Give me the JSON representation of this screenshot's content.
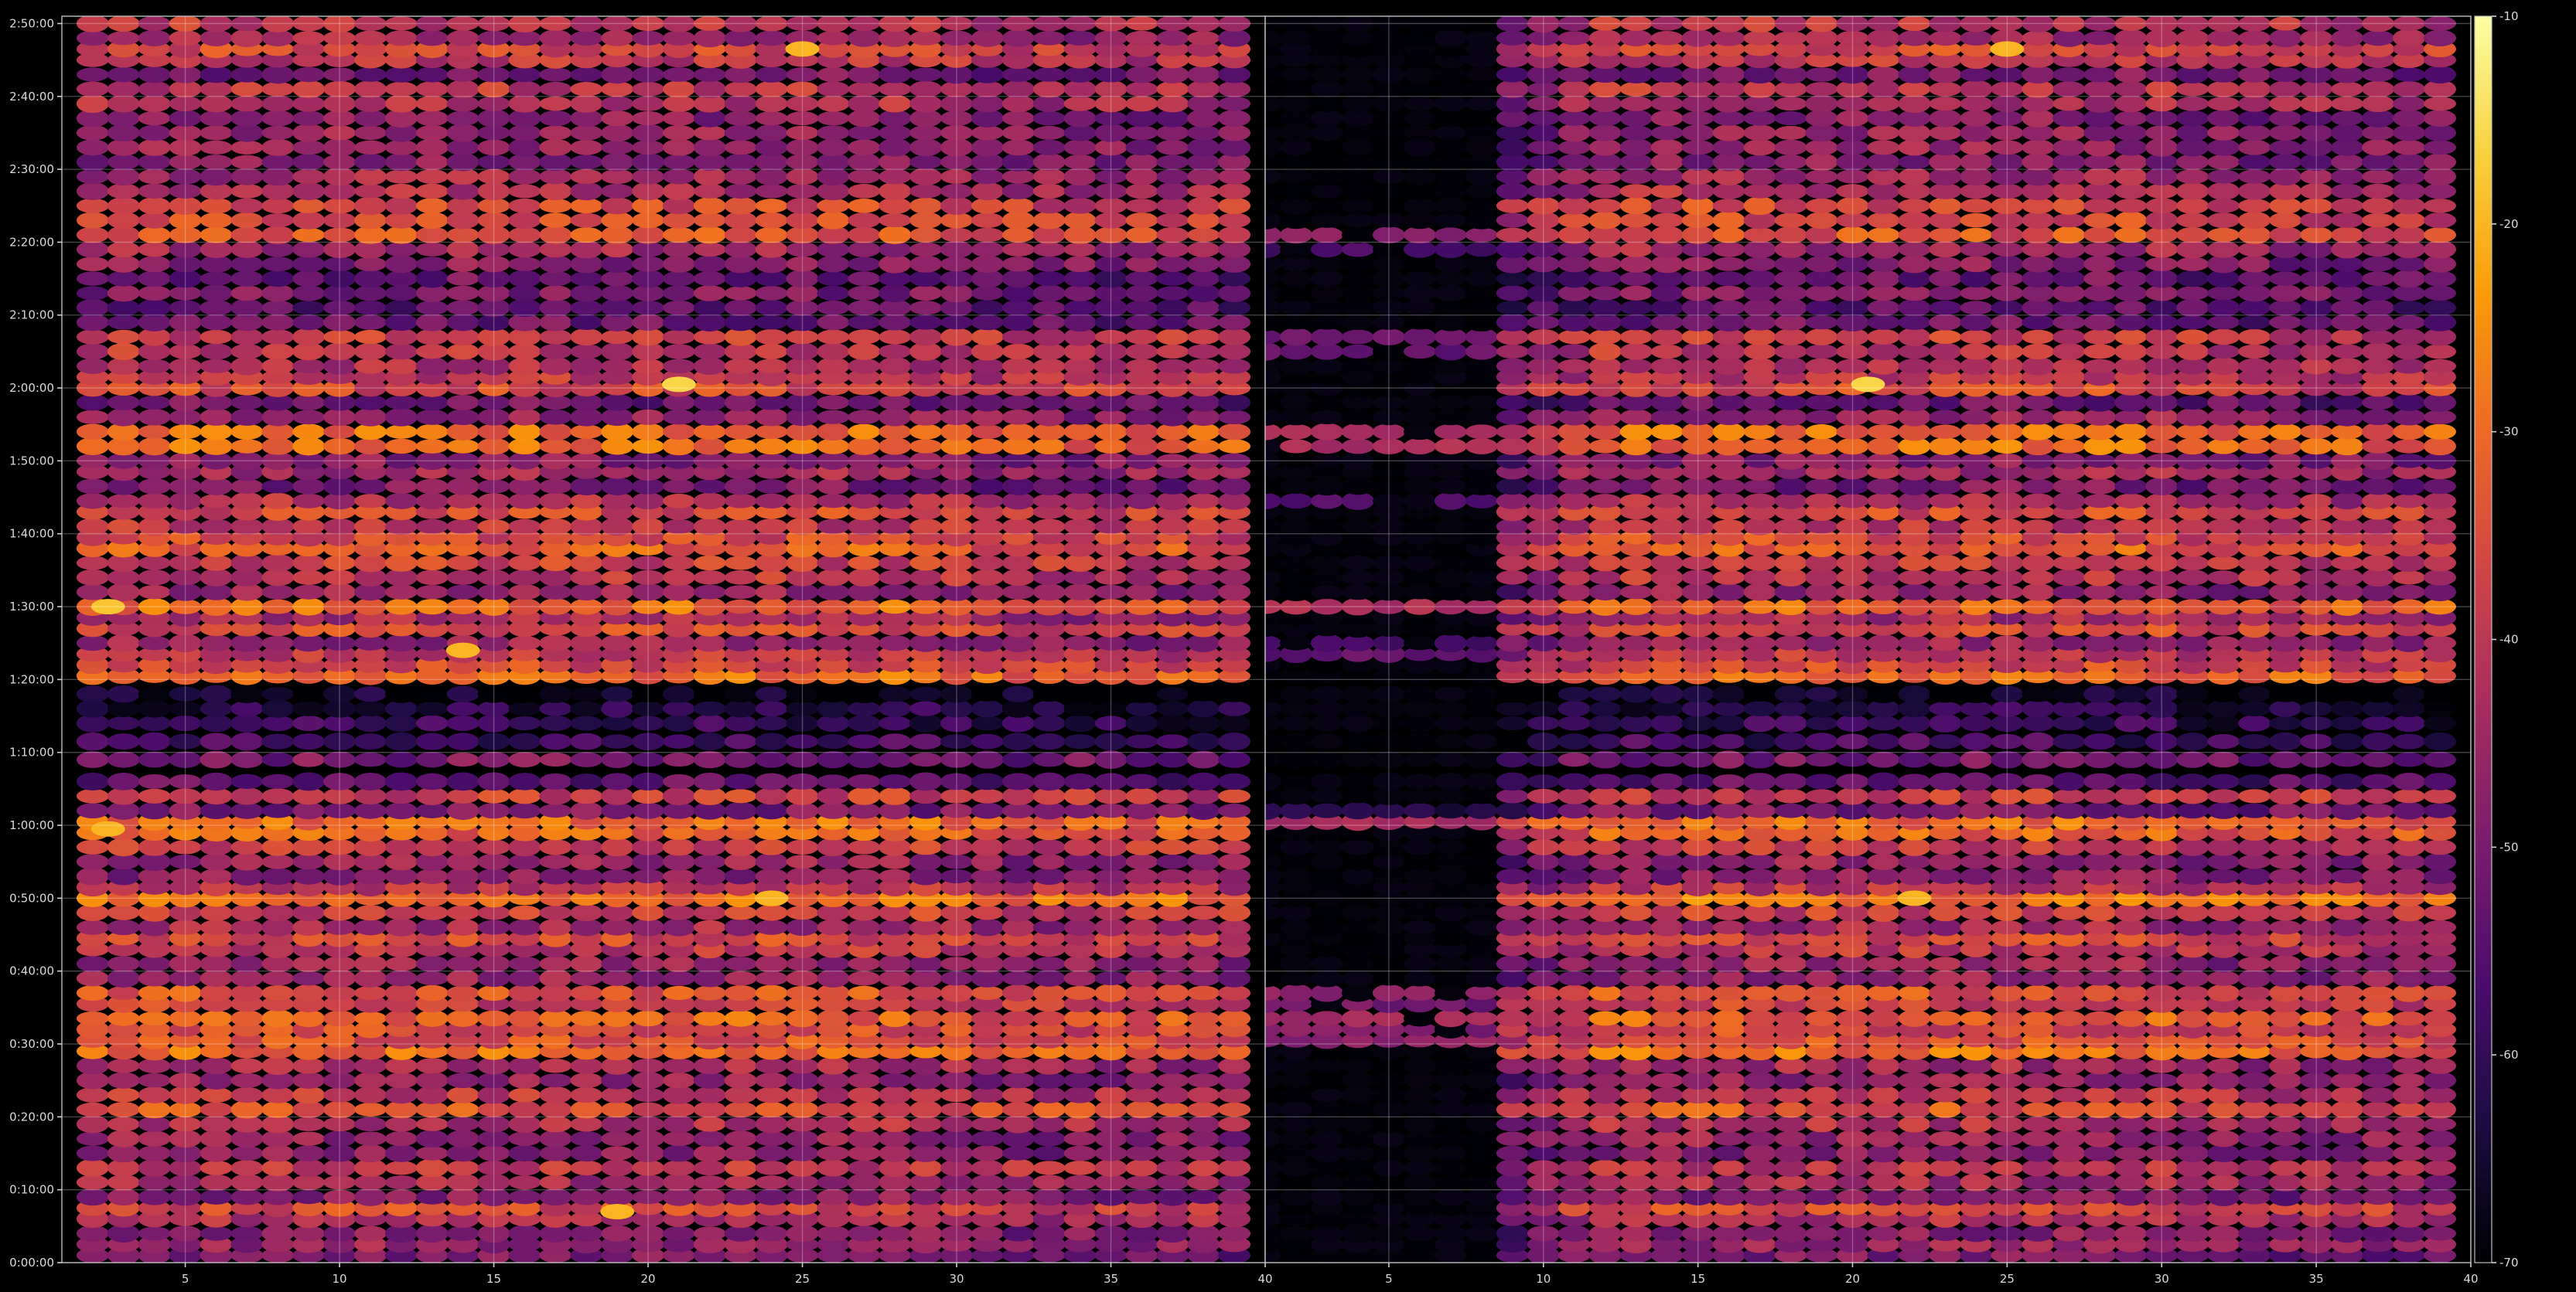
{
  "chart_data": {
    "type": "heatmap",
    "title": "",
    "xlabel": "",
    "ylabel": "",
    "grid": true,
    "colormap": "inferno",
    "colormap_stops": [
      "#000004",
      "#1b0c41",
      "#4a0c6b",
      "#781c6d",
      "#a52c60",
      "#cf4446",
      "#ed6925",
      "#fb9b06",
      "#f7d13d",
      "#fcffa4"
    ],
    "background": "#000000",
    "colorbar": {
      "range": [
        -70,
        -10
      ],
      "ticks": [
        -10,
        -20,
        -30,
        -40,
        -50,
        -60,
        -70
      ],
      "tick_labels": [
        "-10",
        "-20",
        "-30",
        "-40",
        "-50",
        "-60",
        "-70"
      ]
    },
    "panels": [
      {
        "name": "left",
        "xlim": [
          1,
          40
        ],
        "x_ticks": [
          5,
          10,
          15,
          20,
          25,
          30,
          35,
          40
        ],
        "x_tick_labels": [
          "5",
          "10",
          "15",
          "20",
          "25",
          "30",
          "35",
          "40"
        ],
        "x_values": [
          2,
          39
        ],
        "y_tick_labels": [
          "0:00:00",
          "0:10:00",
          "0:20:00",
          "0:30:00",
          "0:40:00",
          "0:50:00",
          "1:00:00",
          "1:10:00",
          "1:20:00",
          "1:30:00",
          "1:40:00",
          "1:50:00",
          "2:00:00",
          "2:10:00",
          "2:20:00",
          "2:30:00",
          "2:40:00",
          "2:50:00"
        ]
      },
      {
        "name": "right",
        "xlim": [
          1,
          40
        ],
        "x_ticks": [
          5,
          10,
          15,
          20,
          25,
          30,
          35,
          40
        ],
        "x_tick_labels": [
          "5",
          "10",
          "15",
          "20",
          "25",
          "30",
          "35",
          "40"
        ],
        "x_values": [
          1,
          39
        ]
      }
    ],
    "ylim_minutes": [
      0,
      171
    ],
    "y_ticks_minutes": [
      0,
      10,
      20,
      30,
      40,
      50,
      60,
      70,
      80,
      90,
      100,
      110,
      120,
      130,
      140,
      150,
      160,
      170
    ],
    "left_rows": [
      {
        "minute": 1,
        "level": -50
      },
      {
        "minute": 2.5,
        "level": -46
      },
      {
        "minute": 4,
        "level": -48
      },
      {
        "minute": 6,
        "level": -42
      },
      {
        "minute": 7.5,
        "level": -36
      },
      {
        "minute": 9,
        "level": -48
      },
      {
        "minute": 11,
        "level": -44
      },
      {
        "minute": 13,
        "level": -40
      },
      {
        "minute": 15,
        "level": -48
      },
      {
        "minute": 17,
        "level": -46
      },
      {
        "minute": 19,
        "level": -42
      },
      {
        "minute": 21,
        "level": -34
      },
      {
        "minute": 23,
        "level": -40
      },
      {
        "minute": 25,
        "level": -46
      },
      {
        "minute": 27,
        "level": -44
      },
      {
        "minute": 29,
        "level": -30
      },
      {
        "minute": 30.5,
        "level": -34
      },
      {
        "minute": 32,
        "level": -36
      },
      {
        "minute": 33.5,
        "level": -32
      },
      {
        "minute": 35.5,
        "level": -38
      },
      {
        "minute": 37,
        "level": -34
      },
      {
        "minute": 39,
        "level": -46
      },
      {
        "minute": 41,
        "level": -46
      },
      {
        "minute": 43,
        "level": -40
      },
      {
        "minute": 44.5,
        "level": -36
      },
      {
        "minute": 46,
        "level": -44
      },
      {
        "minute": 48,
        "level": -38
      },
      {
        "minute": 50,
        "level": -28
      },
      {
        "minute": 51.5,
        "level": -40
      },
      {
        "minute": 53,
        "level": -48
      },
      {
        "minute": 55,
        "level": -46
      },
      {
        "minute": 57,
        "level": -38
      },
      {
        "minute": 59,
        "level": -32
      },
      {
        "minute": 60.5,
        "level": -30
      },
      {
        "minute": 62,
        "level": -50
      },
      {
        "minute": 64,
        "level": -38
      },
      {
        "minute": 66,
        "level": -54
      },
      {
        "minute": 69,
        "level": -50
      },
      {
        "minute": 71.5,
        "level": -58
      },
      {
        "minute": 74,
        "level": -60
      },
      {
        "minute": 76,
        "level": -62
      },
      {
        "minute": 78,
        "level": -66
      },
      {
        "minute": 80.5,
        "level": -30
      },
      {
        "minute": 82,
        "level": -36
      },
      {
        "minute": 83.5,
        "level": -40
      },
      {
        "minute": 85,
        "level": -46
      },
      {
        "minute": 87,
        "level": -36
      },
      {
        "minute": 88.5,
        "level": -44
      },
      {
        "minute": 90,
        "level": -30
      },
      {
        "minute": 92,
        "level": -46
      },
      {
        "minute": 94,
        "level": -40
      },
      {
        "minute": 96,
        "level": -38
      },
      {
        "minute": 98,
        "level": -32
      },
      {
        "minute": 99.5,
        "level": -36
      },
      {
        "minute": 101,
        "level": -40
      },
      {
        "minute": 103,
        "level": -36
      },
      {
        "minute": 104.5,
        "level": -42
      },
      {
        "minute": 106.5,
        "level": -50
      },
      {
        "minute": 108.5,
        "level": -44
      },
      {
        "minute": 110,
        "level": -48
      },
      {
        "minute": 112,
        "level": -30
      },
      {
        "minute": 114,
        "level": -30
      },
      {
        "minute": 116,
        "level": -46
      },
      {
        "minute": 118,
        "level": -52
      },
      {
        "minute": 120,
        "level": -36
      },
      {
        "minute": 121.5,
        "level": -40
      },
      {
        "minute": 123,
        "level": -42
      },
      {
        "minute": 125,
        "level": -40
      },
      {
        "minute": 127,
        "level": -38
      },
      {
        "minute": 129,
        "level": -52
      },
      {
        "minute": 131,
        "level": -54
      },
      {
        "minute": 133,
        "level": -50
      },
      {
        "minute": 135,
        "level": -52
      },
      {
        "minute": 137,
        "level": -48
      },
      {
        "minute": 139,
        "level": -44
      },
      {
        "minute": 141,
        "level": -34
      },
      {
        "minute": 143,
        "level": -36
      },
      {
        "minute": 145,
        "level": -36
      },
      {
        "minute": 147,
        "level": -42
      },
      {
        "minute": 149,
        "level": -44
      },
      {
        "minute": 151,
        "level": -48
      },
      {
        "minute": 153,
        "level": -46
      },
      {
        "minute": 155,
        "level": -46
      },
      {
        "minute": 157,
        "level": -48
      },
      {
        "minute": 159,
        "level": -42
      },
      {
        "minute": 161,
        "level": -40
      },
      {
        "minute": 163,
        "level": -50
      },
      {
        "minute": 165,
        "level": -40
      },
      {
        "minute": 166.5,
        "level": -36
      },
      {
        "minute": 168,
        "level": -44
      },
      {
        "minute": 170,
        "level": -40
      }
    ],
    "right_empty_x_max": 8,
    "right_scattered_left_rows_minutes": [
      30.5,
      32,
      33.5,
      35.5,
      37,
      60.5,
      62,
      83.5,
      85,
      90,
      104.5,
      112,
      114,
      125,
      127,
      139,
      141
    ],
    "hotspots": [
      {
        "panel": "left",
        "x": 2.5,
        "minute": 59.5,
        "level": -20
      },
      {
        "panel": "left",
        "x": 2.5,
        "minute": 90,
        "level": -18
      },
      {
        "panel": "left",
        "x": 21,
        "minute": 120.5,
        "level": -16
      },
      {
        "panel": "left",
        "x": 24,
        "minute": 50,
        "level": -20
      },
      {
        "panel": "left",
        "x": 14,
        "minute": 84,
        "level": -20
      },
      {
        "panel": "left",
        "x": 25,
        "minute": 166.5,
        "level": -20
      },
      {
        "panel": "left",
        "x": 19,
        "minute": 7,
        "level": -20
      },
      {
        "panel": "right",
        "x": 20.5,
        "minute": 120.5,
        "level": -16
      },
      {
        "panel": "right",
        "x": 22,
        "minute": 50,
        "level": -20
      },
      {
        "panel": "right",
        "x": 25,
        "minute": 166.5,
        "level": -20
      }
    ]
  }
}
